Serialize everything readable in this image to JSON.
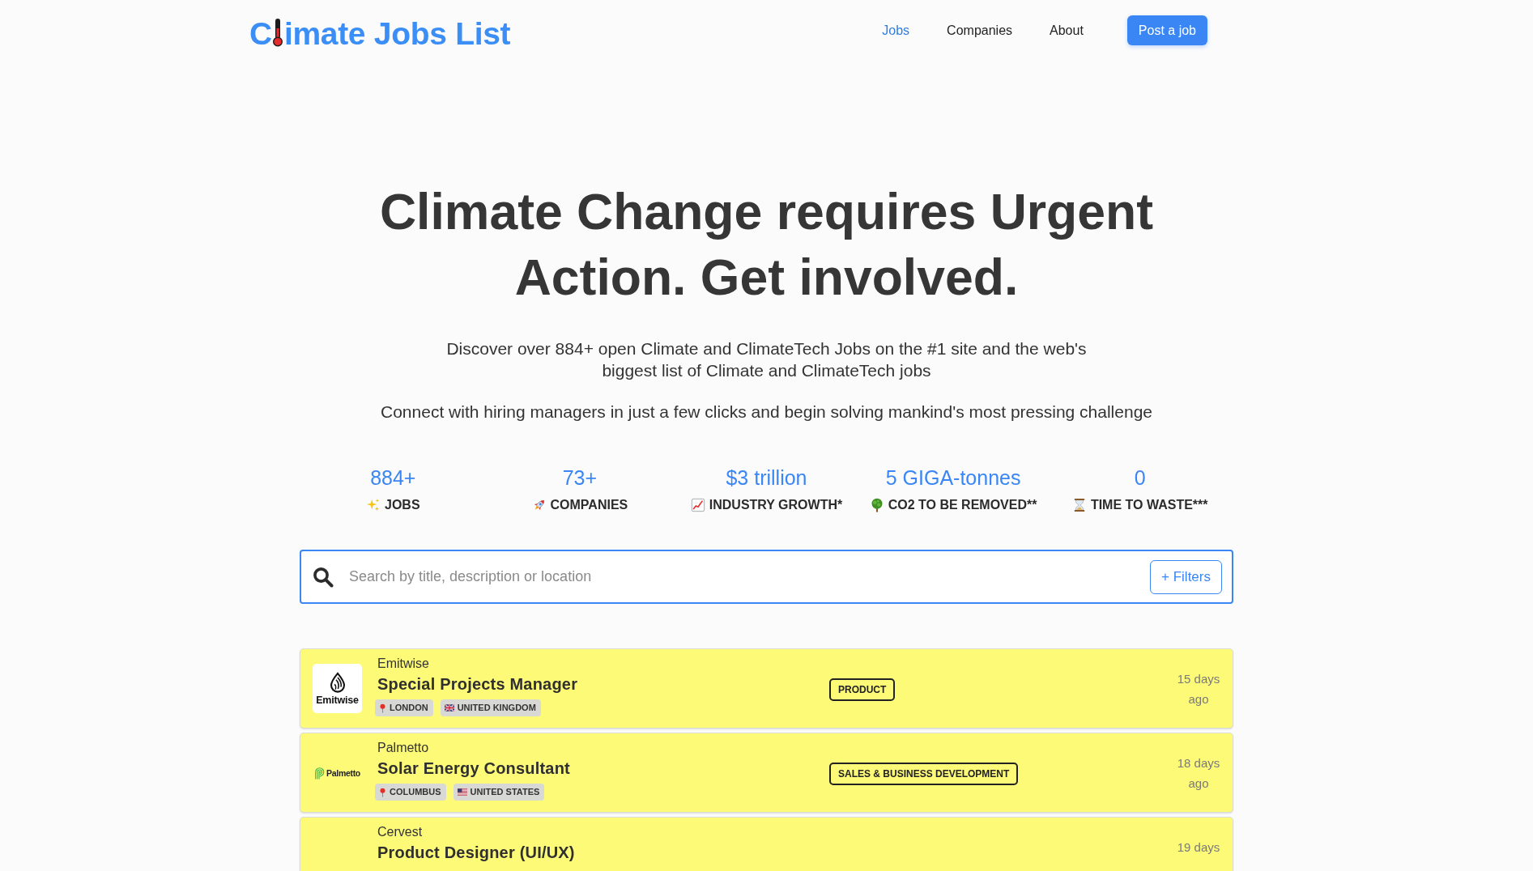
{
  "header": {
    "logo": {
      "lead": "C",
      "rest": "imate Jobs List"
    },
    "nav": [
      {
        "label": "Jobs",
        "selected": true
      },
      {
        "label": "Companies",
        "selected": false
      },
      {
        "label": "About",
        "selected": false
      }
    ],
    "cta": "Post a job"
  },
  "hero": {
    "title": "Climate Change requires Urgent Action. Get involved.",
    "intro": "Discover over 884+ open Climate and ClimateTech Jobs on the #1 site and the web's biggest list of Climate and ClimateTech jobs",
    "tagline": "Connect with hiring managers in just a few clicks and begin solving mankind's most pressing challenge"
  },
  "stats": [
    {
      "value": "884+",
      "label": "JOBS"
    },
    {
      "value": "73+",
      "label": "COMPANIES"
    },
    {
      "value": "$3 trillion",
      "label": "INDUSTRY GROWTH*"
    },
    {
      "value": "5 GIGA-tonnes",
      "label": "CO2 TO BE REMOVED**"
    },
    {
      "value": "0",
      "label": "TIME TO WASTE***"
    }
  ],
  "search": {
    "placeholder": "Search by title, description or location",
    "filters_button": "+ Filters"
  },
  "jobs": [
    {
      "company": "Emitwise",
      "logo": {
        "kind": "tile",
        "text": "Emitwise"
      },
      "title": "Special Projects Manager",
      "locations": [
        {
          "kind": "city",
          "label": "LONDON"
        },
        {
          "kind": "uk",
          "label": "UNITED KINGDOM"
        }
      ],
      "category": "PRODUCT",
      "posted": "15 days ago"
    },
    {
      "company": "Palmetto",
      "logo": {
        "kind": "mark",
        "text": "Palmetto"
      },
      "title": "Solar Energy Consultant",
      "locations": [
        {
          "kind": "city",
          "label": "COLUMBUS"
        },
        {
          "kind": "us",
          "label": "UNITED STATES"
        }
      ],
      "category": "SALES & BUSINESS DEVELOPMENT",
      "posted": "18 days ago"
    },
    {
      "company": "Cervest",
      "title": "Product Designer (UI/UX)",
      "posted": "19 days"
    }
  ]
}
